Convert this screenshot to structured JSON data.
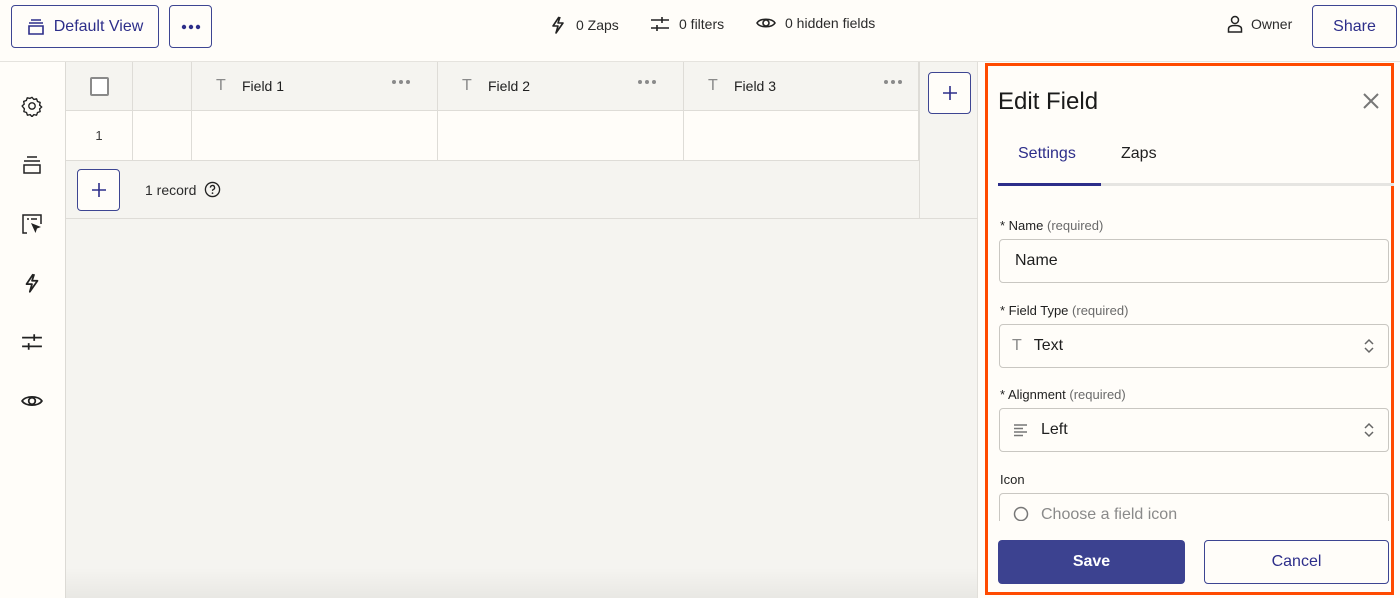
{
  "toolbar": {
    "view_label": "Default View",
    "view_icon": "stack-icon",
    "more_icon": "ellipsis-icon",
    "zaps_label": "0 Zaps",
    "filters_label": "0 filters",
    "hidden_fields_label": "0 hidden fields",
    "owner_label": "Owner",
    "share_label": "Share"
  },
  "rail": {
    "items": [
      {
        "name": "settings",
        "icon": "gear-icon"
      },
      {
        "name": "views",
        "icon": "stack-icon"
      },
      {
        "name": "interfaces",
        "icon": "cursor-window-icon"
      },
      {
        "name": "zaps",
        "icon": "lightning-icon"
      },
      {
        "name": "filters",
        "icon": "sliders-icon"
      },
      {
        "name": "hidden-fields",
        "icon": "eye-icon"
      }
    ]
  },
  "table": {
    "columns": [
      {
        "label": "Field 1",
        "type_icon": "T"
      },
      {
        "label": "Field 2",
        "type_icon": "T"
      },
      {
        "label": "Field 3",
        "type_icon": "T"
      }
    ],
    "rows": [
      {
        "number": "1",
        "cells": [
          "",
          "",
          ""
        ]
      }
    ],
    "record_count": "1 record"
  },
  "panel": {
    "title": "Edit Field",
    "tabs": [
      {
        "label": "Settings",
        "active": true
      },
      {
        "label": "Zaps",
        "active": false
      }
    ],
    "name": {
      "label": "* Name",
      "hint": "(required)",
      "value": "Name"
    },
    "field_type": {
      "label": "* Field Type",
      "hint": "(required)",
      "icon": "T",
      "value": "Text"
    },
    "alignment": {
      "label": "* Alignment",
      "hint": "(required)",
      "value": "Left"
    },
    "icon": {
      "label": "Icon",
      "placeholder": "Choose a field icon"
    },
    "save_label": "Save",
    "cancel_label": "Cancel"
  },
  "colors": {
    "brand": "#2d2e8a",
    "save_bg": "#3c4290",
    "highlight": "#ff4a00"
  }
}
